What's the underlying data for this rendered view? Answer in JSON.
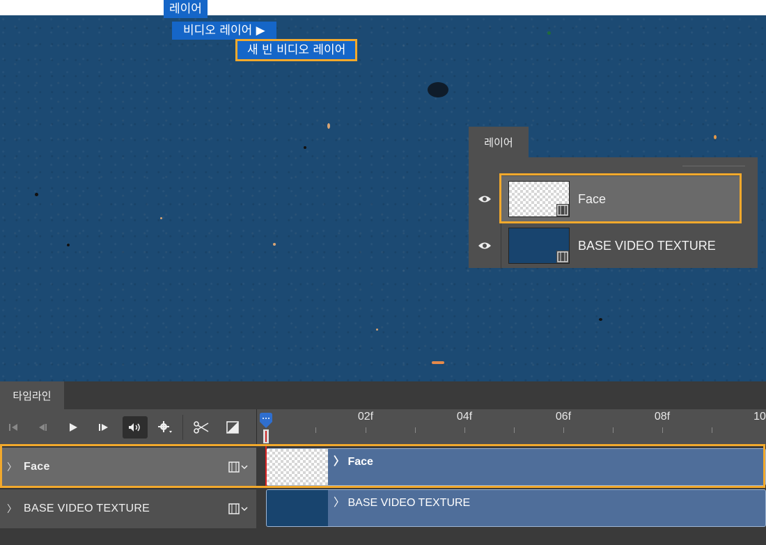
{
  "menu": {
    "layer": "레이어",
    "video_layer": "비디오 레이어 ▶",
    "new_blank_video_layer": "새 빈 비디오 레이어"
  },
  "layers_panel": {
    "tab_label": "레이어",
    "layers": [
      {
        "name": "Face",
        "selected": true,
        "visible": true,
        "thumbnail": "transparent-checker"
      },
      {
        "name": "BASE VIDEO TEXTURE",
        "selected": false,
        "visible": true,
        "thumbnail": "navy-texture"
      }
    ]
  },
  "timeline": {
    "tab_label": "타임라인",
    "controls": [
      {
        "name": "go-to-first-frame",
        "icon": "skip-start-icon"
      },
      {
        "name": "previous-frame",
        "icon": "step-back-icon"
      },
      {
        "name": "play",
        "icon": "play-icon"
      },
      {
        "name": "next-frame",
        "icon": "step-forward-icon"
      },
      {
        "name": "audio",
        "icon": "speaker-icon"
      },
      {
        "name": "settings",
        "icon": "gear-icon"
      },
      {
        "name": "split-at-playhead",
        "icon": "scissors-icon"
      },
      {
        "name": "transition",
        "icon": "transition-icon"
      }
    ],
    "ruler_labels": [
      "02f",
      "04f",
      "06f",
      "08f",
      "10"
    ],
    "tracks": [
      {
        "name": "Face",
        "clip_label": "Face",
        "selected": true
      },
      {
        "name": "BASE VIDEO TEXTURE",
        "clip_label": "BASE VIDEO TEXTURE",
        "selected": false
      }
    ]
  },
  "colors": {
    "highlight": "#f2a92c",
    "menu_blue": "#1566c8",
    "canvas_blue": "#1c4a73",
    "clip_blue": "#4f6e9a",
    "playhead": "#2f6fcf"
  },
  "chevron": "〉"
}
